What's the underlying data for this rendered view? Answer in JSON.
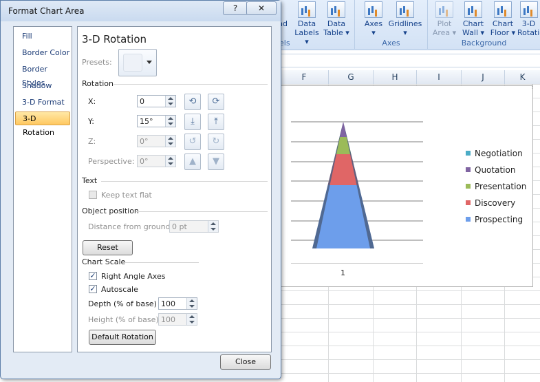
{
  "ribbon": {
    "buttons": [
      {
        "label1": "nd",
        "label2": "",
        "disabled": false
      },
      {
        "label1": "Data",
        "label2": "Labels ▾",
        "disabled": false
      },
      {
        "label1": "Data",
        "label2": "Table ▾",
        "disabled": false
      },
      {
        "label1": "Axes",
        "label2": "▾",
        "disabled": false
      },
      {
        "label1": "Gridlines",
        "label2": "▾",
        "disabled": false
      },
      {
        "label1": "Plot",
        "label2": "Area ▾",
        "disabled": true
      },
      {
        "label1": "Chart",
        "label2": "Wall ▾",
        "disabled": false
      },
      {
        "label1": "Chart",
        "label2": "Floor ▾",
        "disabled": false
      },
      {
        "label1": "3-D",
        "label2": "Rotatio",
        "disabled": false
      }
    ],
    "groups": [
      "els",
      "Axes",
      "Background"
    ]
  },
  "columns": [
    "F",
    "G",
    "H",
    "I",
    "J",
    "K"
  ],
  "dialog": {
    "title": "Format Chart Area",
    "help": "?",
    "close": "✕",
    "nav": [
      "Fill",
      "Border Color",
      "Border Styles",
      "Shadow",
      "3-D Format",
      "3-D Rotation"
    ],
    "selected_nav": "3-D Rotation",
    "heading": "3-D Rotation",
    "presets_label": "Presets:",
    "rotation": {
      "section": "Rotation",
      "x_label": "X:",
      "x_value": "0",
      "y_label": "Y:",
      "y_value": "15°",
      "z_label": "Z:",
      "z_value": "0°",
      "perspective_label": "Perspective:",
      "perspective_value": "0°"
    },
    "text": {
      "section": "Text",
      "keep_flat_label": "Keep text flat"
    },
    "object_position": {
      "section": "Object position",
      "distance_label": "Distance from ground:",
      "distance_value": "0 pt"
    },
    "reset_label": "Reset",
    "chart_scale": {
      "section": "Chart Scale",
      "right_angle_label": "Right Angle Axes",
      "autoscale_label": "Autoscale",
      "depth_label": "Depth (% of base)",
      "depth_value": "100",
      "height_label": "Height (% of base)",
      "height_value": "100",
      "default_rotation_label": "Default Rotation"
    },
    "close_label": "Close"
  },
  "chart_data": {
    "type": "bar",
    "categories": [
      "1"
    ],
    "series": [
      {
        "name": "Negotiation",
        "color": "#4bacc6"
      },
      {
        "name": "Quotation",
        "color": "#8064a2"
      },
      {
        "name": "Presentation",
        "color": "#9bbb59"
      },
      {
        "name": "Discovery",
        "color": "#e06666"
      },
      {
        "name": "Prospecting",
        "color": "#6d9eeb"
      }
    ],
    "xlabel": "",
    "ylabel": "",
    "grid": true,
    "legend": "right"
  }
}
